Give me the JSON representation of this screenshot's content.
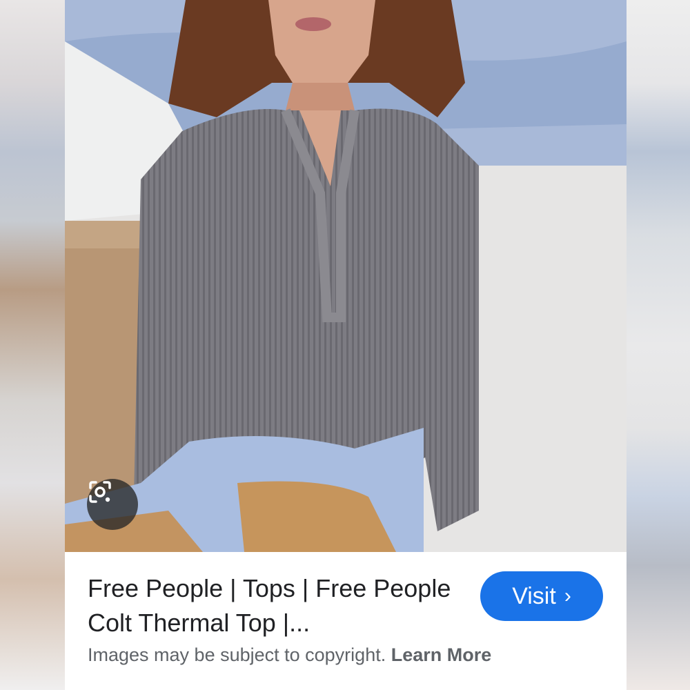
{
  "result": {
    "title": "Free People | Tops | Free People Colt Thermal Top |...",
    "visit_label": "Visit",
    "visit_icon": "chevron-right-icon",
    "copyright_text": "Images may be subject to copyright.",
    "learn_more_label": "Learn More"
  },
  "photo": {
    "description_icon": "google-lens-icon"
  },
  "colors": {
    "accent": "#1a73e8",
    "title_text": "#202124",
    "secondary_text": "#5f6368"
  }
}
